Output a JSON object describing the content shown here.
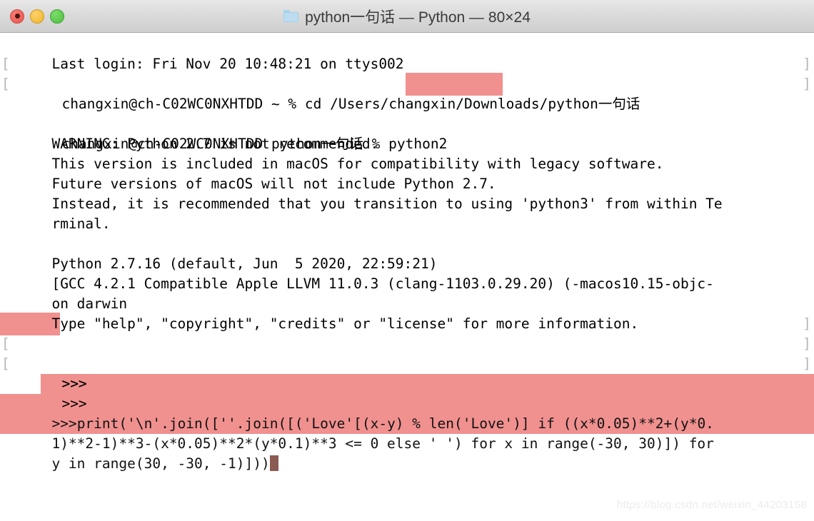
{
  "window": {
    "title": "python一句话 — Python — 80×24",
    "folder_icon": "folder-icon",
    "traffic_lights": {
      "close_label": "close",
      "minimize_label": "minimize",
      "zoom_label": "zoom"
    }
  },
  "colors": {
    "highlight_pink": "#f0918f",
    "cursor": "#8a5a53",
    "titlebar_bg": "#d8d8d8",
    "text": "#000000",
    "edge_marker": "#b5b5b5",
    "watermark": "#ececec"
  },
  "terminal": {
    "bracket_left": "[",
    "bracket_right": "]",
    "lines": [
      {
        "id": "last-login",
        "text": "Last login: Fri Nov 20 10:48:21 on ttys002"
      },
      {
        "id": "cd-command",
        "text": "changxin@ch-C02WC0NXHTDD ~ % cd /Users/changxin/Downloads/python一句话"
      },
      {
        "id": "python2-command-prefix",
        "text": "changxin@ch-C02WC0NXHTDD python一句话 % ",
        "highlight": "python2"
      },
      {
        "id": "blank-1",
        "text": ""
      },
      {
        "id": "warn-1",
        "text": "WARNING: Python 2.7 is not recommended."
      },
      {
        "id": "warn-2",
        "text": "This version is included in macOS for compatibility with legacy software."
      },
      {
        "id": "warn-3",
        "text": "Future versions of macOS will not include Python 2.7."
      },
      {
        "id": "warn-4",
        "text": "Instead, it is recommended that you transition to using 'python3' from within Te"
      },
      {
        "id": "warn-5",
        "text": "rminal."
      },
      {
        "id": "blank-2",
        "text": ""
      },
      {
        "id": "banner-1",
        "text": "Python 2.7.16 (default, Jun  5 2020, 22:59:21)"
      },
      {
        "id": "banner-2",
        "text": "[GCC 4.2.1 Compatible Apple LLVM 11.0.3 (clang-1103.0.29.20) (-macos10.15-objc-"
      },
      {
        "id": "banner-3",
        "text": "on darwin"
      },
      {
        "id": "banner-4",
        "text": "Type \"help\", \"copyright\", \"credits\" or \"license\" for more information."
      }
    ],
    "prompts": [
      {
        "id": "prompt-1",
        "text": ">>>",
        "highlighted": true
      },
      {
        "id": "prompt-2",
        "text": ">>>",
        "highlighted": false
      },
      {
        "id": "prompt-3",
        "text": ">>>",
        "highlighted": false
      }
    ],
    "command": {
      "prompt": ">>>",
      "line1": "print('\\n'.join([''.join([('Love'[(x-y) % len('Love')] if ((x*0.05)**2+(y*0.",
      "line2": "1)**2-1)**3-(x*0.05)**2*(y*0.1)**3 <= 0 else ' ') for x in range(-30, 30)]) for",
      "line3": "y in range(30, -30, -1)]))"
    }
  },
  "watermark": {
    "text": "https://blog.csdn.net/weixin_44203158"
  }
}
